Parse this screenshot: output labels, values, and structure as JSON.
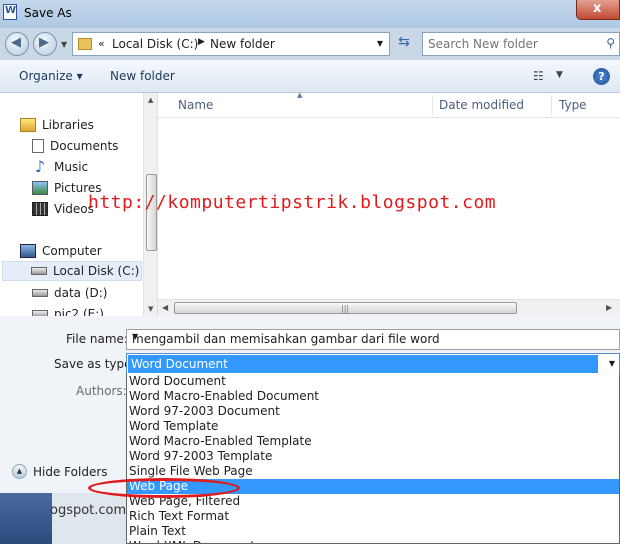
{
  "window": {
    "title": "Save As",
    "close_glyph": "x"
  },
  "address": {
    "crumbs": [
      "Local Disk (C:)",
      "New folder"
    ],
    "separator_root": "«",
    "separator": "▶"
  },
  "search": {
    "placeholder": "Search New folder"
  },
  "toolbar": {
    "organize": "Organize ▾",
    "new_folder": "New folder",
    "help": "?"
  },
  "nav": {
    "items": [
      {
        "label": "Libraries",
        "icon": "library-icon"
      },
      {
        "label": "Documents",
        "icon": "documents-icon"
      },
      {
        "label": "Music",
        "icon": "music-icon"
      },
      {
        "label": "Pictures",
        "icon": "pictures-icon"
      },
      {
        "label": "Videos",
        "icon": "videos-icon"
      },
      {
        "label": "Computer",
        "icon": "computer-icon"
      },
      {
        "label": "Local Disk (C:)",
        "icon": "drive-icon"
      },
      {
        "label": "data (D:)",
        "icon": "drive-icon"
      },
      {
        "label": "pic2 (E:)",
        "icon": "drive-icon"
      }
    ]
  },
  "filelist": {
    "columns": [
      "Name",
      "Date modified",
      "Type"
    ]
  },
  "form": {
    "filename_label": "File name:",
    "filename_value": "mengambil dan memisahkan gambar dari file word",
    "savetype_label": "Save as type:",
    "savetype_value": "Word Document",
    "authors_label": "Authors:",
    "hide_folders": "Hide Folders"
  },
  "dropdown": {
    "options": [
      "Word Document",
      "Word Macro-Enabled Document",
      "Word 97-2003 Document",
      "Word Template",
      "Word Macro-Enabled Template",
      "Word 97-2003 Template",
      "Single File Web Page",
      "Web Page",
      "Web Page, Filtered",
      "Rich Text Format",
      "Plain Text",
      "Word XML Document"
    ],
    "selected_index": 7
  },
  "background": {
    "text": "ogspot.com"
  },
  "annotation": {
    "watermark": "http://komputertipstrik.blogspot.com",
    "highlight_color": "#e01b1b"
  }
}
